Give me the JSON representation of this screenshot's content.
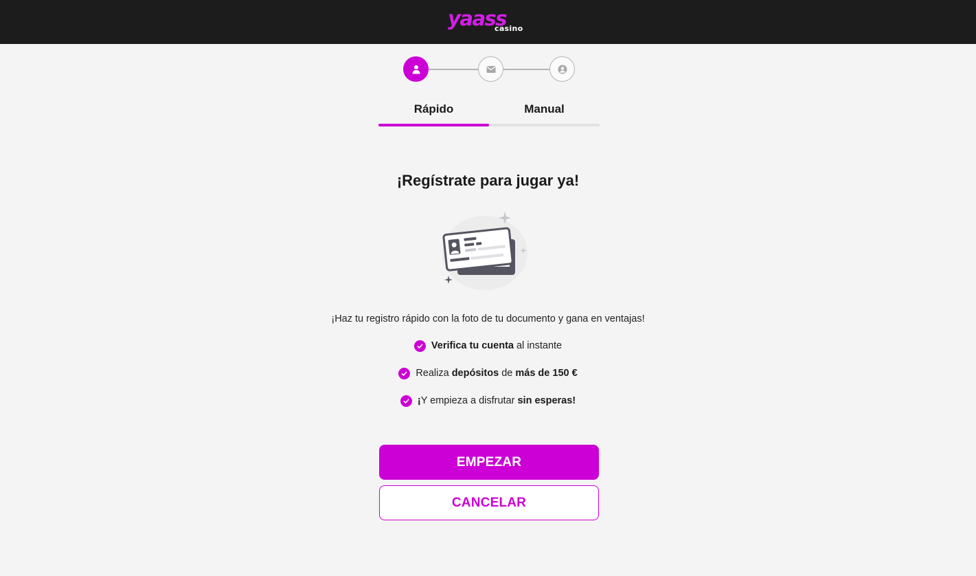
{
  "brand": {
    "logo_main": "yaass",
    "logo_sub": "casino",
    "accent": "#cc00d6",
    "header_bg": "#1c1c1c",
    "page_bg": "#f4f4f4"
  },
  "stepper": {
    "steps": [
      {
        "icon": "user-icon",
        "state": "active"
      },
      {
        "icon": "envelope-icon",
        "state": "inactive"
      },
      {
        "icon": "user-circle-icon",
        "state": "inactive"
      }
    ]
  },
  "tabs": {
    "items": [
      {
        "label": "Rápido",
        "selected": true
      },
      {
        "label": "Manual",
        "selected": false
      }
    ]
  },
  "main": {
    "title": "¡Regístrate para  jugar ya!",
    "illustration": "id-card-illustration",
    "description": "¡Haz tu registro rápido con la foto de tu documento y gana en ventajas!",
    "benefits": [
      {
        "icon": "check-circle-icon",
        "b1_bold": "Verifica tu cuenta",
        "b1_rest": " al instante"
      },
      {
        "icon": "check-circle-icon",
        "b2_pre": "Realiza ",
        "b2_bold1": "depósitos",
        "b2_mid": " de ",
        "b2_bold2": "más de 150 €"
      },
      {
        "icon": "check-circle-icon",
        "b3_bold1": "¡",
        "b3_mid": "Y empieza a disfrutar ",
        "b3_bold2": "sin esperas!"
      }
    ]
  },
  "buttons": {
    "start": "EMPEZAR",
    "cancel": "CANCELAR"
  }
}
